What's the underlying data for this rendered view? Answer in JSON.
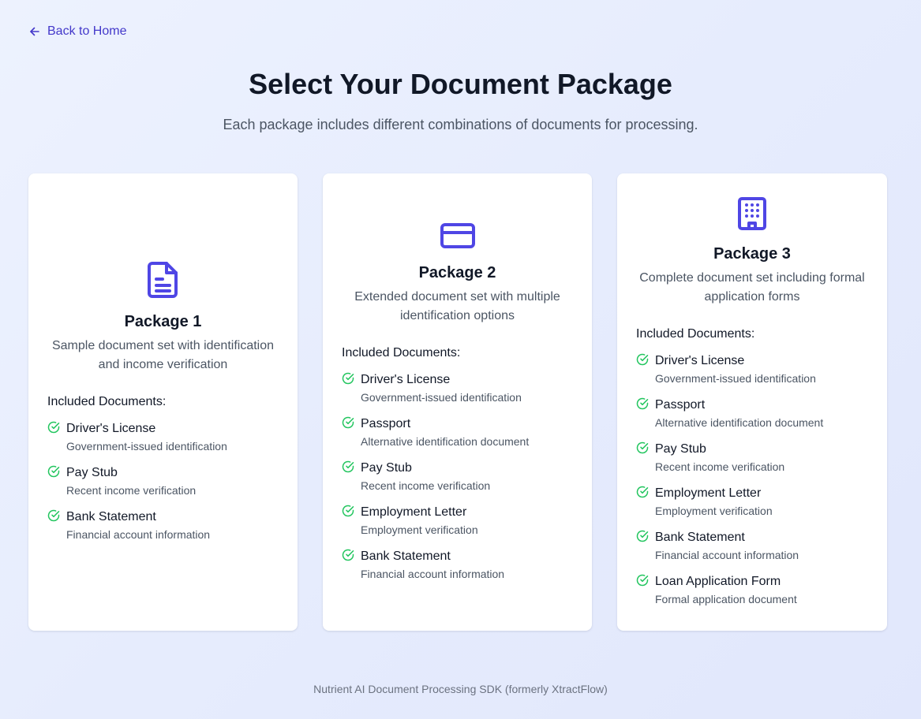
{
  "back_link": {
    "label": "Back to Home",
    "icon": "arrow-left-icon"
  },
  "header": {
    "title": "Select Your Document Package",
    "subtitle": "Each package includes different combinations of documents for processing."
  },
  "colors": {
    "accent": "#4f46e5",
    "link": "#4338ca",
    "check": "#22c55e",
    "text": "#111827",
    "muted": "#4b5563",
    "card_bg": "#ffffff"
  },
  "packages": [
    {
      "title": "Package 1",
      "icon": "document-icon",
      "description": "Sample document set with identification and income verification",
      "docs_heading": "Included Documents:",
      "documents": [
        {
          "name": "Driver's License",
          "detail": "Government-issued identification"
        },
        {
          "name": "Pay Stub",
          "detail": "Recent income verification"
        },
        {
          "name": "Bank Statement",
          "detail": "Financial account information"
        }
      ]
    },
    {
      "title": "Package 2",
      "icon": "credit-card-icon",
      "description": "Extended document set with multiple identification options",
      "docs_heading": "Included Documents:",
      "documents": [
        {
          "name": "Driver's License",
          "detail": "Government-issued identification"
        },
        {
          "name": "Passport",
          "detail": "Alternative identification document"
        },
        {
          "name": "Pay Stub",
          "detail": "Recent income verification"
        },
        {
          "name": "Employment Letter",
          "detail": "Employment verification"
        },
        {
          "name": "Bank Statement",
          "detail": "Financial account information"
        }
      ]
    },
    {
      "title": "Package 3",
      "icon": "building-icon",
      "description": "Complete document set including formal application forms",
      "docs_heading": "Included Documents:",
      "documents": [
        {
          "name": "Driver's License",
          "detail": "Government-issued identification"
        },
        {
          "name": "Passport",
          "detail": "Alternative identification document"
        },
        {
          "name": "Pay Stub",
          "detail": "Recent income verification"
        },
        {
          "name": "Employment Letter",
          "detail": "Employment verification"
        },
        {
          "name": "Bank Statement",
          "detail": "Financial account information"
        },
        {
          "name": "Loan Application Form",
          "detail": "Formal application document"
        }
      ]
    }
  ],
  "footer": {
    "text": "Nutrient AI Document Processing SDK (formerly XtractFlow)"
  }
}
